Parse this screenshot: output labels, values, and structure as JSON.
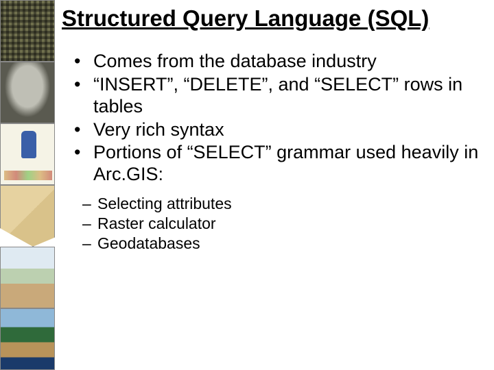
{
  "title": "Structured Query Language (SQL)",
  "bullets": [
    "Comes from the database industry",
    "“INSERT”, “DELETE”, and “SELECT” rows in tables",
    "Very rich syntax",
    "Portions of “SELECT” grammar used heavily in Arc.GIS:"
  ],
  "sub_bullets": [
    "Selecting attributes",
    "Raster calculator",
    "Geodatabases"
  ],
  "sidebar_thumbs": [
    "grid-pattern-thumb",
    "stone-tablet-thumb",
    "medieval-map-thumb",
    "parchment-map-thumb",
    "relief-map-thumb",
    "globe-americas-thumb"
  ]
}
